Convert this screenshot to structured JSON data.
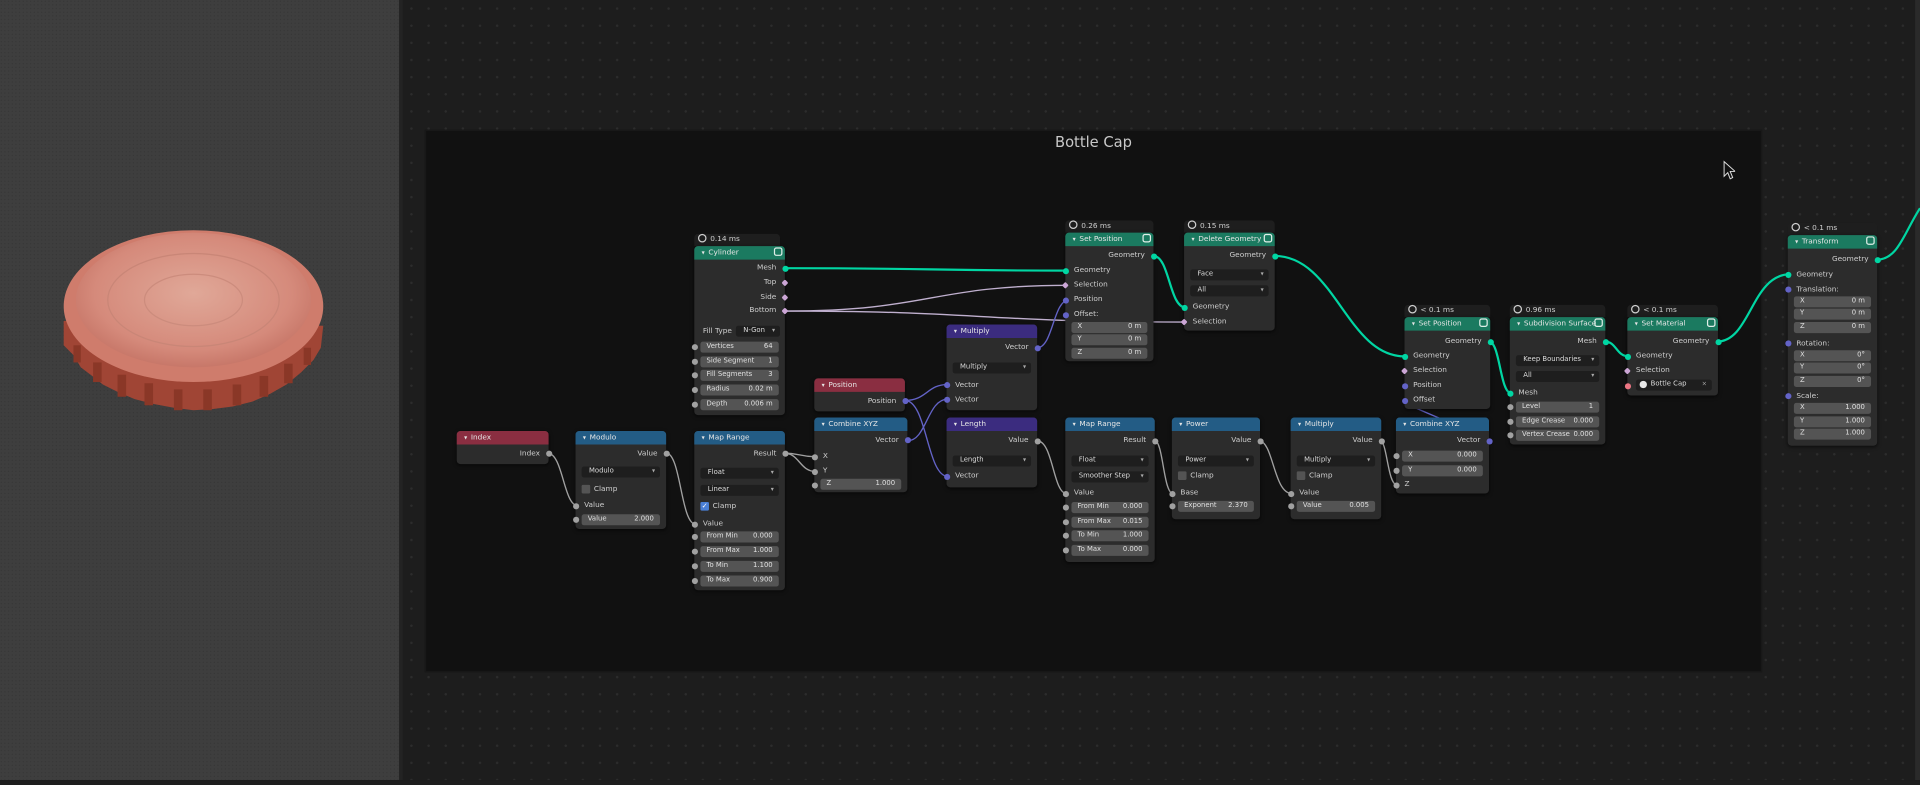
{
  "frame": {
    "title": "Bottle Cap"
  },
  "colors": {
    "geometry_socket": "#00d6a3",
    "vector_socket": "#6363c7",
    "float_socket": "#a1a1a1",
    "geometry_header": "#1b7a60",
    "converter_header": "#235c85",
    "vector_header": "#3b2c7f",
    "input_header": "#8a2e41"
  },
  "nodes": {
    "index": {
      "title": "Index",
      "out": "Index"
    },
    "modulo": {
      "title": "Modulo",
      "out": "Value",
      "op": "Modulo",
      "clamp": "Clamp",
      "in": "Value",
      "val_label": "Value",
      "val": "2.000"
    },
    "maprange1": {
      "title": "Map Range",
      "out": "Result",
      "dtype": "Float",
      "interp": "Linear",
      "clamp": "Clamp",
      "in": "Value",
      "f1l": "From Min",
      "f1v": "0.000",
      "f2l": "From Max",
      "f2v": "1.000",
      "f3l": "To Min",
      "f3v": "1.100",
      "f4l": "To Max",
      "f4v": "0.900"
    },
    "cylinder": {
      "timer": "0.14 ms",
      "title": "Cylinder",
      "o1": "Mesh",
      "o2": "Top",
      "o3": "Side",
      "o4": "Bottom",
      "fill_label": "Fill Type",
      "fill_val": "N-Gon",
      "f1l": "Vertices",
      "f1v": "64",
      "f2l": "Side Segment",
      "f2v": "1",
      "f3l": "Fill Segments",
      "f3v": "3",
      "f4l": "Radius",
      "f4v": "0.02 m",
      "f5l": "Depth",
      "f5v": "0.006 m"
    },
    "position": {
      "title": "Position",
      "out": "Position"
    },
    "combine1": {
      "title": "Combine XYZ",
      "out": "Vector",
      "x": "X",
      "y": "Y",
      "zl": "Z",
      "zv": "1.000"
    },
    "multiply_v": {
      "title": "Multiply",
      "out": "Vector",
      "op": "Multiply",
      "i1": "Vector",
      "i2": "Vector"
    },
    "length": {
      "title": "Length",
      "out": "Value",
      "op": "Length",
      "in": "Vector"
    },
    "maprange2": {
      "title": "Map Range",
      "out": "Result",
      "dtype": "Float",
      "interp": "Smoother Step",
      "in": "Value",
      "f1l": "From Min",
      "f1v": "0.000",
      "f2l": "From Max",
      "f2v": "0.015",
      "f3l": "To Min",
      "f3v": "1.000",
      "f4l": "To Max",
      "f4v": "0.000"
    },
    "power": {
      "title": "Power",
      "out": "Value",
      "op": "Power",
      "clamp": "Clamp",
      "base": "Base",
      "el": "Exponent",
      "ev": "2.370"
    },
    "multiply2": {
      "title": "Multiply",
      "out": "Value",
      "op": "Multiply",
      "clamp": "Clamp",
      "in": "Value",
      "vl": "Value",
      "vv": "0.005"
    },
    "combine2": {
      "title": "Combine XYZ",
      "out": "Vector",
      "xl": "X",
      "xv": "0.000",
      "yl": "Y",
      "yv": "0.000",
      "z": "Z"
    },
    "setpos1": {
      "timer": "0.26 ms",
      "title": "Set Position",
      "out": "Geometry",
      "i1": "Geometry",
      "i2": "Selection",
      "i3": "Position",
      "i4": "Offset:",
      "xl": "X",
      "xv": "0 m",
      "yl": "Y",
      "yv": "0 m",
      "zl": "Z",
      "zv": "0 m"
    },
    "delete": {
      "timer": "0.15 ms",
      "title": "Delete Geometry",
      "out": "Geometry",
      "d1": "Face",
      "d2": "All",
      "i1": "Geometry",
      "i2": "Selection"
    },
    "setpos2": {
      "timer": "< 0.1 ms",
      "title": "Set Position",
      "out": "Geometry",
      "i1": "Geometry",
      "i2": "Selection",
      "i3": "Position",
      "i4": "Offset"
    },
    "subdiv": {
      "timer": "0.96 ms",
      "title": "Subdivision Surface",
      "out": "Mesh",
      "d1": "Keep Boundaries",
      "d2": "All",
      "in": "Mesh",
      "f1l": "Level",
      "f1v": "1",
      "f2l": "Edge Crease",
      "f2v": "0.000",
      "f3l": "Vertex Crease",
      "f3v": "0.000"
    },
    "setmat": {
      "timer": "< 0.1 ms",
      "title": "Set Material",
      "out": "Geometry",
      "i1": "Geometry",
      "i2": "Selection",
      "mat": "Bottle Cap",
      "x": "×"
    },
    "transform": {
      "timer": "< 0.1 ms",
      "title": "Transform",
      "out": "Geometry",
      "in": "Geometry",
      "t": "Translation:",
      "txl": "X",
      "txv": "0 m",
      "tyl": "Y",
      "tyv": "0 m",
      "tzl": "Z",
      "tzv": "0 m",
      "r": "Rotation:",
      "rxl": "X",
      "rxv": "0°",
      "ryl": "Y",
      "ryv": "0°",
      "rzl": "Z",
      "rzv": "0°",
      "s": "Scale:",
      "sxl": "X",
      "sxv": "1.000",
      "syl": "Y",
      "syv": "1.000",
      "szl": "Z",
      "szv": "1.000"
    }
  }
}
